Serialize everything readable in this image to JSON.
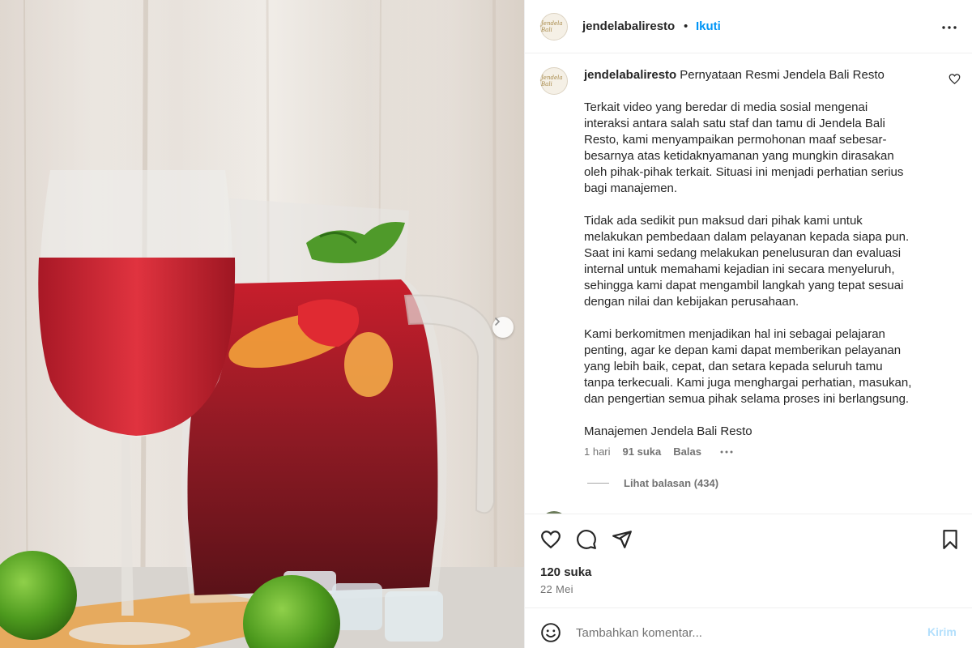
{
  "post": {
    "username": "jendelabaliresto",
    "follow_label": "Ikuti",
    "separator": "•",
    "avatar_text": "Jendela Bali"
  },
  "caption": {
    "username": "jendelabaliresto",
    "title": "Pernyataan Resmi Jendela Bali Resto",
    "paragraph1": [
      "Terkait video yang beredar di media sosial mengenai",
      "interaksi antara salah satu staf dan tamu di Jendela Bali",
      "Resto, kami menyampaikan permohonan maaf sebesar-",
      "besarnya atas ketidaknyamanan yang mungkin dirasakan",
      "oleh pihak-pihak terkait. Situasi ini menjadi perhatian serius",
      "bagi manajemen."
    ],
    "paragraph2": [
      "Tidak ada sedikit pun maksud dari pihak kami untuk",
      "melakukan pembedaan dalam pelayanan kepada siapa pun.",
      "Saat ini kami sedang melakukan penelusuran dan evaluasi",
      "internal untuk memahami kejadian ini secara menyeluruh,",
      "sehingga kami dapat mengambil langkah yang tepat sesuai",
      "dengan nilai dan kebijakan perusahaan."
    ],
    "paragraph3": [
      "Kami berkomitmen menjadikan hal ini sebagai pelajaran",
      "penting, agar ke depan kami dapat memberikan pelayanan",
      "yang lebih baik, cepat, dan setara kepada seluruh tamu",
      "tanpa terkecuali. Kami juga menghargai perhatian, masukan,",
      "dan pengertian semua pihak selama proses ini berlangsung."
    ],
    "signature": "Manajemen Jendela Bali Resto",
    "time": "1 hari",
    "likes": "91 suka",
    "reply_label": "Balas",
    "view_replies": "Lihat balasan (434)"
  },
  "footer": {
    "like_count": "120 suka",
    "date": "22 Mei",
    "comment_placeholder": "Tambahkan komentar...",
    "send_label": "Kirim"
  },
  "icons": {
    "more": "more-horizontal-icon",
    "like": "heart-icon",
    "comment": "comment-icon",
    "share": "send-icon",
    "save": "bookmark-icon",
    "emoji": "emoji-icon",
    "next": "chevron-right-icon"
  },
  "colors": {
    "accent": "#0095f6",
    "send_disabled": "#b2dffc",
    "secondary_text": "#737373"
  }
}
